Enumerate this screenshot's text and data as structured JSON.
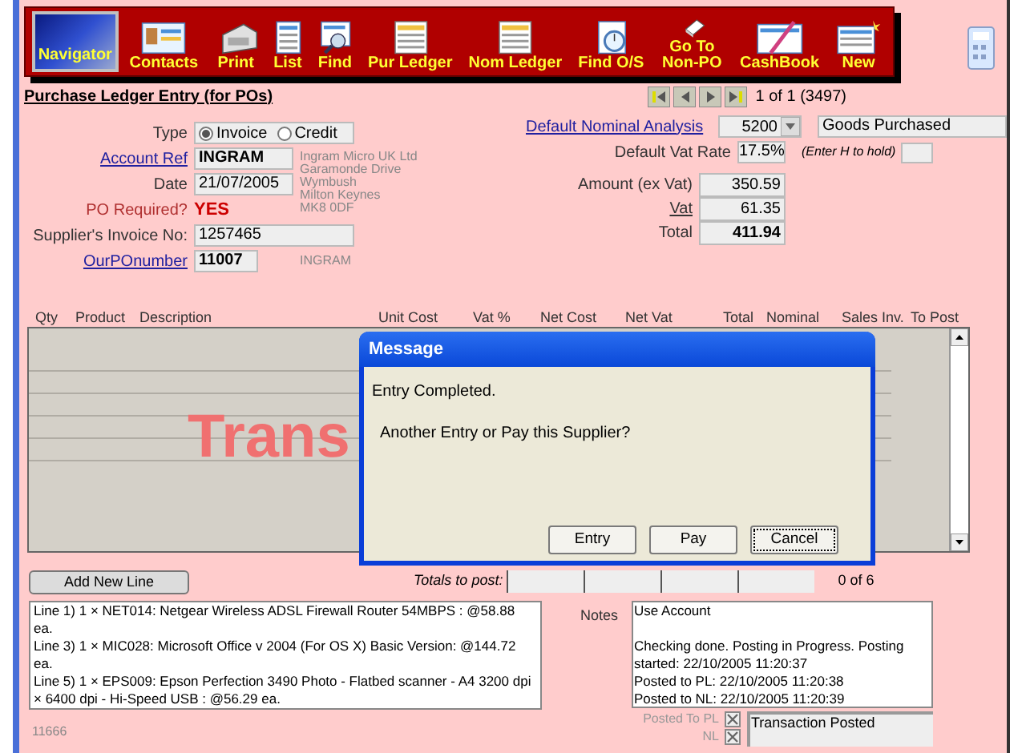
{
  "toolbar": [
    {
      "label": "Navigator",
      "selected": true
    },
    {
      "label": "Contacts",
      "selected": false
    },
    {
      "label": "Print",
      "selected": false
    },
    {
      "label": "List",
      "selected": false
    },
    {
      "label": "Find",
      "selected": false
    },
    {
      "label": "Pur Ledger",
      "selected": false
    },
    {
      "label": "Nom Ledger",
      "selected": false
    },
    {
      "label": "Find O/S",
      "selected": false
    },
    {
      "label": "Go To Non-PO",
      "selected": false
    },
    {
      "label": "CashBook",
      "selected": false
    },
    {
      "label": "New",
      "selected": false
    }
  ],
  "form_title": "Purchase Ledger Entry (for POs)",
  "record_position": "1 of 1 (3497)",
  "type": {
    "label": "Type",
    "options": [
      {
        "label": "Invoice",
        "selected": true
      },
      {
        "label": "Credit",
        "selected": false
      }
    ]
  },
  "account_ref": {
    "label": "Account Ref",
    "value": "INGRAM"
  },
  "address": [
    "Ingram Micro UK Ltd",
    "Garamonde Drive",
    "Wymbush",
    "Milton Keynes",
    "MK8 0DF"
  ],
  "date": {
    "label": "Date",
    "value": "21/07/2005"
  },
  "po_required": {
    "label": "PO Required?",
    "value": "YES"
  },
  "supplier_invoice": {
    "label": "Supplier's Invoice  No:",
    "value": "1257465"
  },
  "our_po": {
    "label": "OurPOnumber",
    "value": "11007",
    "note": "INGRAM"
  },
  "nominal": {
    "label": "Default Nominal Analysis",
    "value": "5200",
    "description": "Goods Purchased"
  },
  "vat_rate": {
    "label": "Default Vat Rate",
    "value": "17.5%"
  },
  "hold": {
    "label": "(Enter H to hold)"
  },
  "amounts": [
    {
      "kind": "plain",
      "label": "Amount (ex Vat)",
      "value": "350.59"
    },
    {
      "kind": "link",
      "label": "Vat",
      "value": "61.35"
    },
    {
      "kind": "total",
      "label": "Total",
      "value": "411.94"
    }
  ],
  "table": {
    "columns": [
      "Qty",
      "Product",
      "Description",
      "Unit Cost",
      "Vat %",
      "Net Cost",
      "Net Vat",
      "Total",
      "Nominal",
      "Sales Inv.",
      "To Post"
    ],
    "stamp": "Trans"
  },
  "add_line_button": "Add New Line",
  "totals": {
    "label": "Totals to post:",
    "count": "0 of 6"
  },
  "lines": [
    "Line 1) 1 × NET014:   Netgear  Wireless ADSL Firewall Router 54MBPS  : @58.88 ea.",
    "Line 3)  1 × MIC028:   Microsoft Office  v 2004  (For OS X)  Basic Version: @144.72 ea.",
    "Line 5)  1 × EPS009:   Epson Perfection 3490 Photo - Flatbed scanner -  A4 3200 dpi × 6400 dpi - Hi-Speed USB  : @56.29 ea."
  ],
  "record_id": "11666",
  "notes": {
    "label": "Notes",
    "lines": [
      "Use Account",
      "Checking done.  Posting in Progress. Posting started: 22/10/2005 11:20:37",
      "Posted to PL:  22/10/2005 11:20:38",
      "Posted to NL:  22/10/2005 11:20:39"
    ]
  },
  "posted": [
    {
      "label": "Posted To PL",
      "checked": true
    },
    {
      "label": "NL",
      "checked": true
    }
  ],
  "status": "Transaction Posted",
  "dialog": {
    "title": "Message",
    "message": "Entry Completed.",
    "question": "Another Entry or Pay this Supplier?",
    "buttons": [
      {
        "label": "Entry",
        "focused": false
      },
      {
        "label": "Pay",
        "focused": false
      },
      {
        "label": "Cancel",
        "focused": true
      }
    ]
  }
}
